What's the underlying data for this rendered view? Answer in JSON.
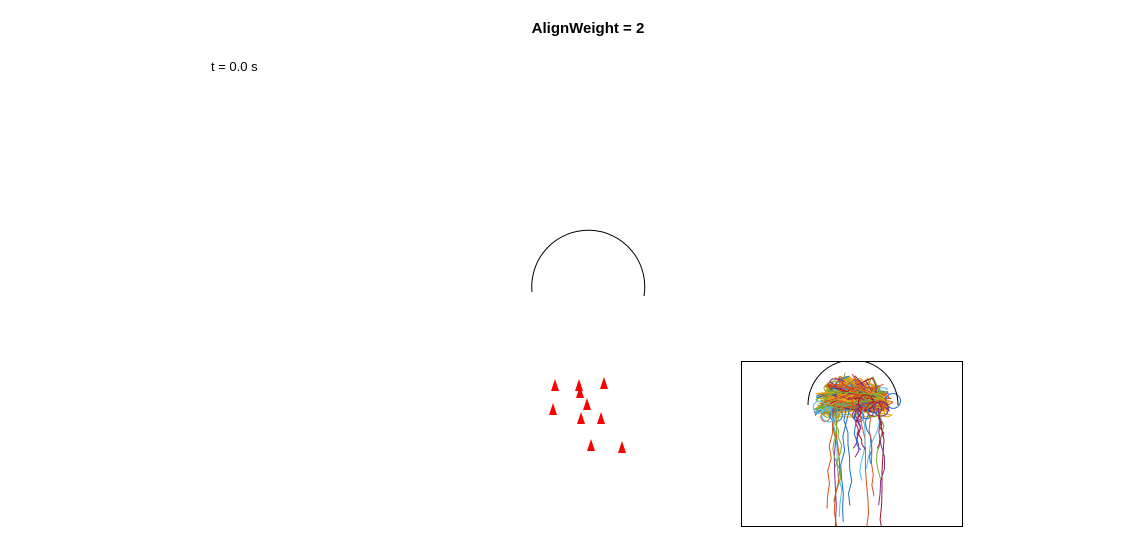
{
  "figure": {
    "title": "AlignWeight = 2",
    "time_label": "t = 0.0 s"
  },
  "colors": {
    "agent": "#ff0000",
    "boundary": "#000000",
    "trail_palette": [
      "#e8a317",
      "#1f6fc5",
      "#d95319",
      "#7e2f8e",
      "#77ac30",
      "#4dbeee",
      "#a2142f"
    ]
  },
  "agents": {
    "count": 11,
    "marker": "filled-triangle"
  }
}
